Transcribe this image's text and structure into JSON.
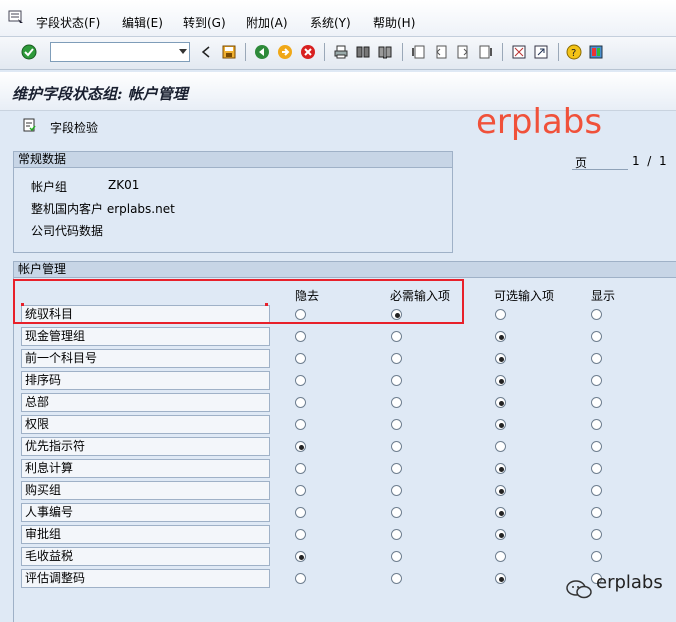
{
  "menubar": {
    "items": [
      "字段状态(F)",
      "编辑(E)",
      "转到(G)",
      "附加(A)",
      "系统(Y)",
      "帮助(H)"
    ]
  },
  "toolbar": {
    "command_field_value": "",
    "icons": [
      "check-icon",
      "back-icon",
      "save-icon",
      "nav-back-icon",
      "exit-icon",
      "cancel-icon",
      "print-icon",
      "find-icon",
      "find-next-icon",
      "first-page-icon",
      "prev-page-icon",
      "next-page-icon",
      "last-page-icon",
      "new-session-icon",
      "shortcut-icon",
      "help-icon",
      "layout-icon"
    ]
  },
  "title": "维护字段状态组: 帐户管理",
  "app_toolbar": {
    "field_check_label": "字段检验"
  },
  "watermark": "erplabs",
  "general_data": {
    "title": "常规数据",
    "account_group_label": "帐户组",
    "account_group_value": "ZK01",
    "description": "整机国内客户 erplabs.net",
    "company_code_label": "公司代码数据"
  },
  "paging": {
    "page_label": "页",
    "page_current": "1",
    "page_sep": "/",
    "page_total": "1"
  },
  "account_mgmt": {
    "title": "帐户管理",
    "columns": [
      "隐去",
      "必需输入项",
      "可选输入项",
      "显示"
    ],
    "rows": [
      {
        "label": "统驭科目",
        "selected": 1
      },
      {
        "label": "现金管理组",
        "selected": 2
      },
      {
        "label": "前一个科目号",
        "selected": 2
      },
      {
        "label": "排序码",
        "selected": 2
      },
      {
        "label": "总部",
        "selected": 2
      },
      {
        "label": "权限",
        "selected": 2
      },
      {
        "label": "优先指示符",
        "selected": 0
      },
      {
        "label": "利息计算",
        "selected": 2
      },
      {
        "label": "购买组",
        "selected": 2
      },
      {
        "label": "人事编号",
        "selected": 2
      },
      {
        "label": "审批组",
        "selected": 2
      },
      {
        "label": "毛收益税",
        "selected": 0
      },
      {
        "label": "评估调整码",
        "selected": 2
      }
    ]
  },
  "footer_brand": "erplabs",
  "colors": {
    "background": "#dfe9f5",
    "highlight": "#e8202a",
    "watermark": "#f0513a"
  }
}
